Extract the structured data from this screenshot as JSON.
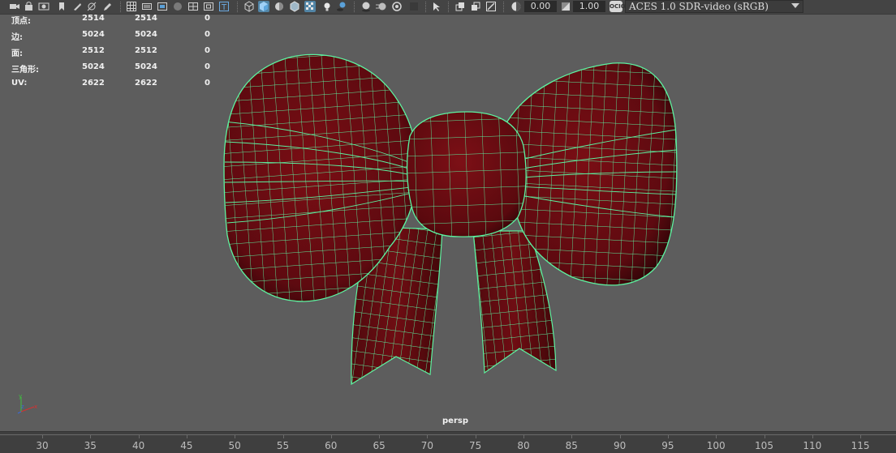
{
  "toolbar": {
    "icons": [
      "camera-icon",
      "camera-lock-icon",
      "camera-attr-icon",
      "bookmark-icon",
      "image-plane-icon",
      "2d-pan-icon",
      "grease-pencil-icon",
      "grid-icon",
      "film-gate-icon",
      "resolution-gate-icon",
      "gate-mask-icon",
      "field-chart-icon",
      "safe-action-icon",
      "safe-title-icon",
      "wireframe-icon",
      "smooth-shade-icon",
      "default-material-icon",
      "wireframe-on-shaded-icon",
      "xray-icon",
      "use-all-lights-icon",
      "shadows-icon",
      "screen-space-ao-icon",
      "motion-blur-icon",
      "anti-alias-icon",
      "depth-of-field-icon",
      "isolate-select-icon",
      "xray-joints-icon",
      "xray-active-icon",
      "backface-icon",
      "exposure-icon",
      "gamma-icon",
      "color-management-icon"
    ],
    "exposure_value": "0.00",
    "gamma_value": "1.00",
    "color_space_badge": "OCIO",
    "color_space": "ACES 1.0 SDR-video (sRGB)"
  },
  "hud": {
    "rows": [
      {
        "label": "顶点:",
        "v1": "2514",
        "v2": "2514",
        "v3": "0"
      },
      {
        "label": "边:",
        "v1": "5024",
        "v2": "5024",
        "v3": "0"
      },
      {
        "label": "面:",
        "v1": "2512",
        "v2": "2512",
        "v3": "0"
      },
      {
        "label": "三角形:",
        "v1": "5024",
        "v2": "5024",
        "v3": "0"
      },
      {
        "label": "UV:",
        "v1": "2622",
        "v2": "2622",
        "v3": "0"
      }
    ]
  },
  "viewport": {
    "camera_label": "persp",
    "mesh_color": "#6e0d12",
    "wire_color": "#5cf2a0",
    "background": "#5d5d5d"
  },
  "timeline": {
    "ticks": [
      "30",
      "35",
      "40",
      "45",
      "50",
      "55",
      "60",
      "65",
      "70",
      "75",
      "80",
      "85",
      "90",
      "95",
      "100",
      "105",
      "110",
      "115"
    ]
  }
}
